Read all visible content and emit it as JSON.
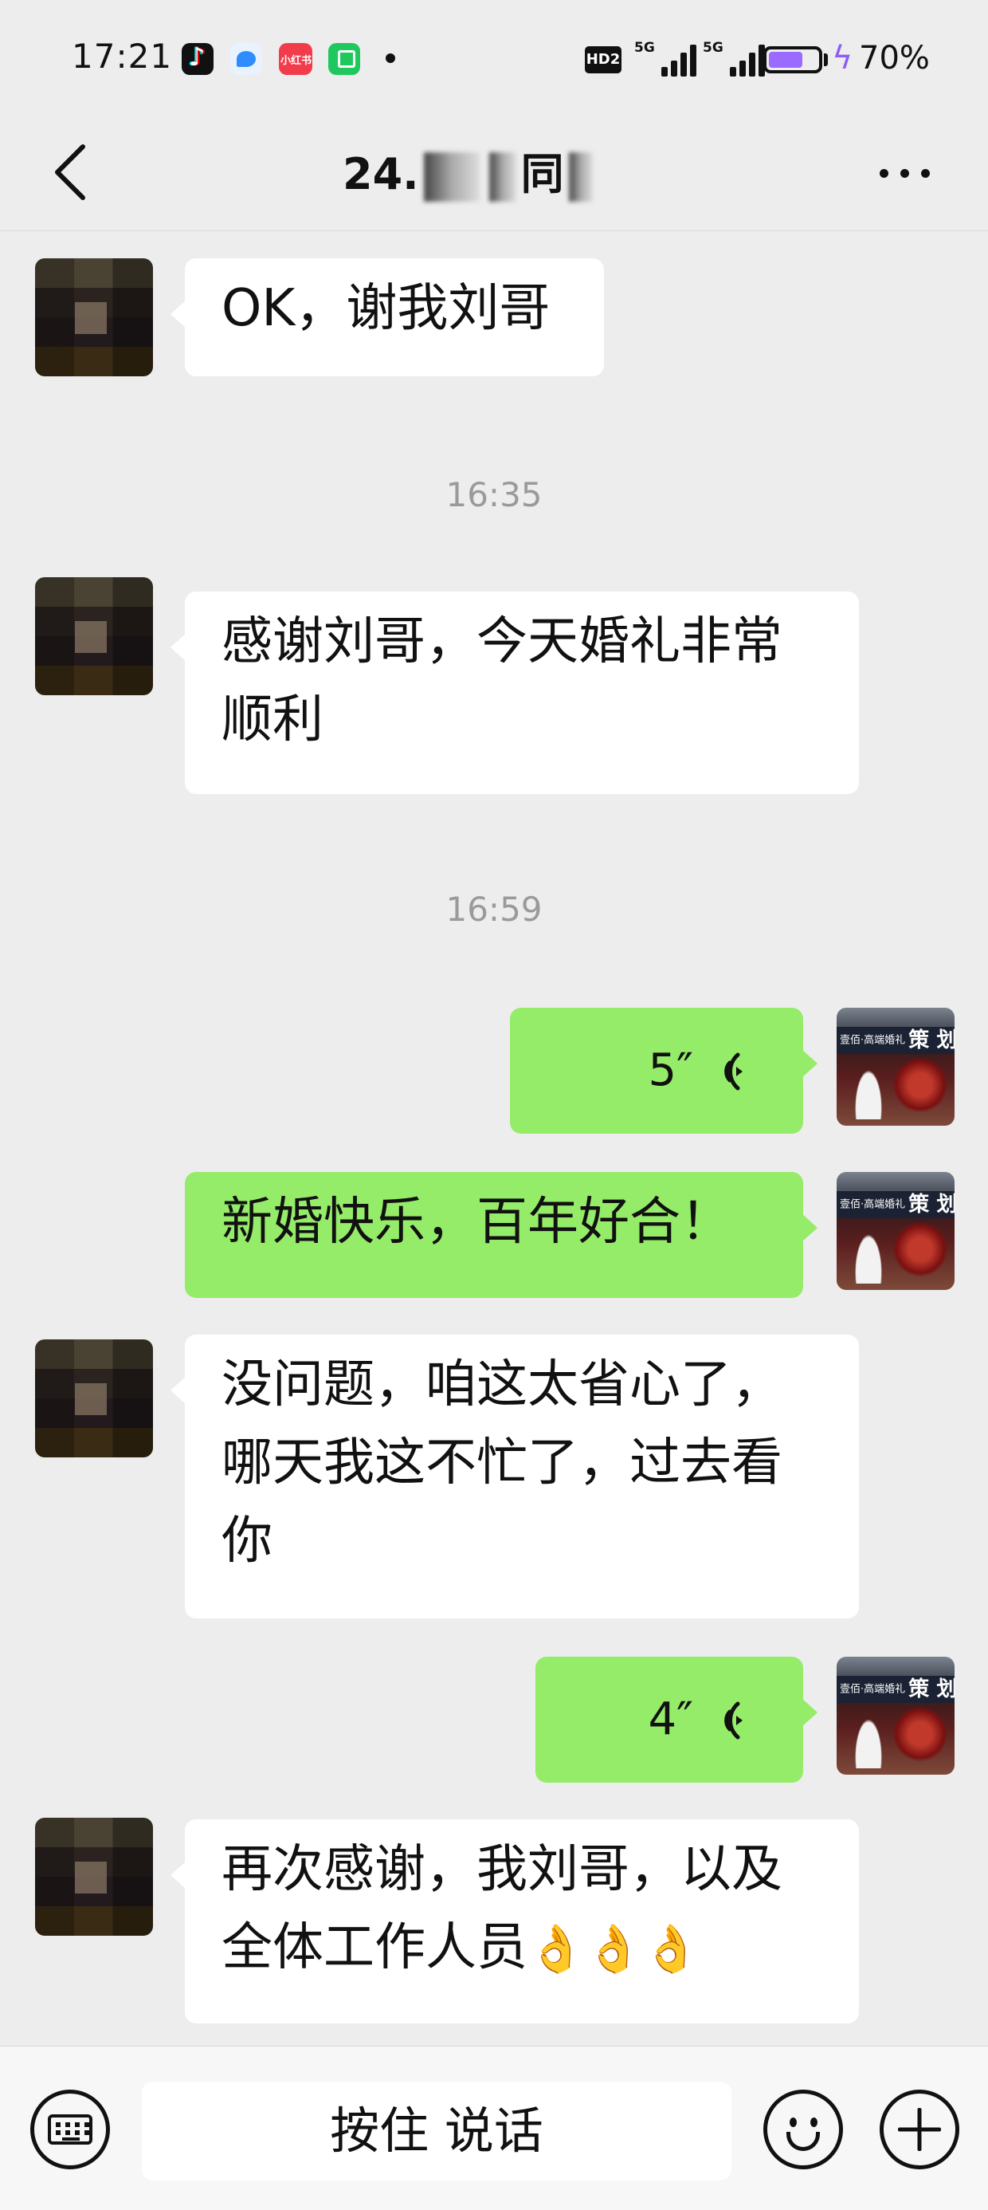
{
  "status_bar": {
    "time": "17:21",
    "app_icons": [
      "tiktok-icon",
      "bird-app-icon",
      "xiaohongshu-icon",
      "green-app-icon"
    ],
    "xiaohongshu_label": "小红书",
    "hd_badge": "HD2",
    "network_1": "5G",
    "network_2": "5G",
    "battery_level": 0.7,
    "battery_text": "70%",
    "battery_color": "#9b6bff"
  },
  "nav": {
    "title_prefix": "24.",
    "title_suffix": "同",
    "back_icon": "chevron-left-icon",
    "more_icon": "more-dots-icon"
  },
  "messages": [
    {
      "sender": "peer",
      "type": "text",
      "text": "OK，谢我刘哥"
    },
    {
      "type": "timestamp",
      "text": "16:35"
    },
    {
      "sender": "peer",
      "type": "text",
      "line1": "感谢刘哥，今天婚礼非常",
      "line2": "顺利"
    },
    {
      "type": "timestamp",
      "text": "16:59"
    },
    {
      "sender": "self",
      "type": "voice",
      "duration": "5″"
    },
    {
      "sender": "self",
      "type": "text",
      "text": "新婚快乐，百年好合！"
    },
    {
      "sender": "peer",
      "type": "text",
      "line1": "没问题，咱这太省心了，",
      "line2": "哪天我这不忙了，过去看",
      "line3": "你"
    },
    {
      "sender": "self",
      "type": "voice",
      "duration": "4″"
    },
    {
      "sender": "peer",
      "type": "text",
      "line1": "再次感谢，我刘哥，以及",
      "line2": "全体工作人员",
      "emoji": "👌👌👌"
    }
  ],
  "self_avatar": {
    "sign_text": "壹佰·高端婚礼",
    "sign_big": "策 划"
  },
  "input_bar": {
    "hold_to_talk": "按住 说话",
    "left_icon": "keyboard-icon",
    "emoji_icon": "smiley-icon",
    "plus_icon": "plus-icon"
  },
  "colors": {
    "background": "#ededed",
    "self_bubble": "#95ec69",
    "peer_bubble": "#ffffff",
    "timestamp": "#9a9a9a"
  }
}
